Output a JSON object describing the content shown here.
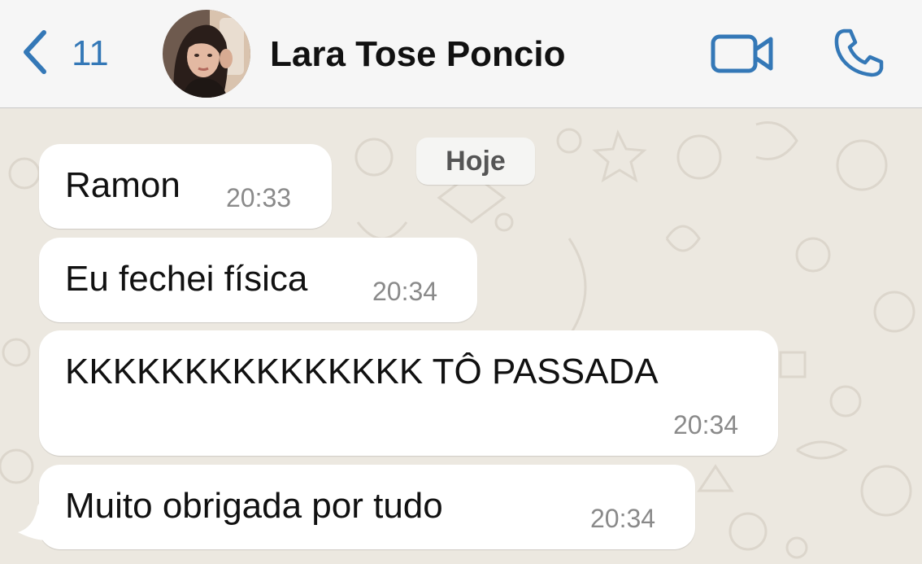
{
  "header": {
    "back_count": "11",
    "contact_name": "Lara Tose Poncio",
    "accent_color": "#3478b7"
  },
  "icons": {
    "back": "chevron-left-icon",
    "video": "video-camera-icon",
    "call": "phone-icon"
  },
  "chat": {
    "date_label": "Hoje",
    "messages": [
      {
        "text": "Ramon",
        "time": "20:33"
      },
      {
        "text": "Eu fechei física",
        "time": "20:34"
      },
      {
        "text": "KKKKKKKKKKKKKKK TÔ PASSADA",
        "time": "20:34"
      },
      {
        "text": "Muito obrigada por tudo",
        "time": "20:34"
      }
    ]
  }
}
